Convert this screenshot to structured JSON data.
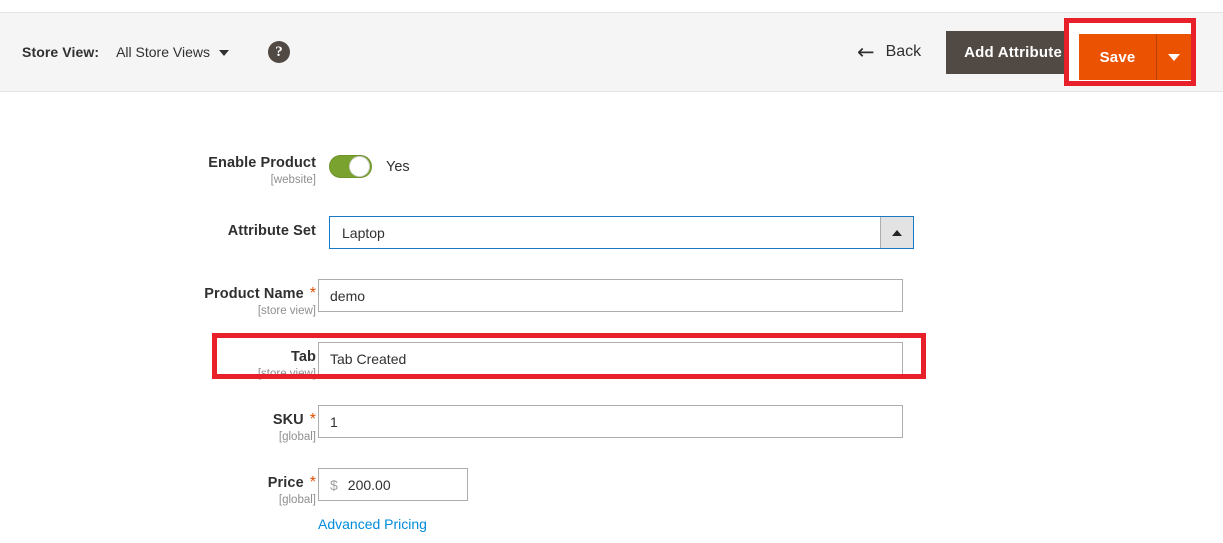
{
  "header": {
    "store_view_label": "Store View:",
    "store_view_value": "All Store Views",
    "store_view_caret_icon": "chevron-down-icon",
    "help_icon": "question-mark-icon",
    "help_glyph": "?",
    "back_arrow_icon": "arrow-left-icon",
    "back_arrow_glyph": "←",
    "back_label": "Back",
    "add_attribute_label": "Add Attribute",
    "save_label": "Save",
    "save_caret_icon": "chevron-down-icon"
  },
  "form": {
    "enable_product": {
      "label": "Enable Product",
      "scope": "[website]",
      "toggle_state": "Yes",
      "toggle_on": true
    },
    "attribute_set": {
      "label": "Attribute Set",
      "value": "Laptop",
      "arrow_icon": "chevron-up-icon"
    },
    "product_name": {
      "label": "Product Name",
      "scope": "[store view]",
      "required": "*",
      "value": "demo"
    },
    "tab": {
      "label": "Tab",
      "scope": "[store view]",
      "value": "Tab Created",
      "highlighted": true
    },
    "sku": {
      "label": "SKU",
      "scope": "[global]",
      "required": "*",
      "value": "1"
    },
    "price": {
      "label": "Price",
      "scope": "[global]",
      "required": "*",
      "currency": "$",
      "value": "200.00",
      "advanced_pricing_label": "Advanced Pricing"
    }
  },
  "colors": {
    "save_orange": "#eb5202",
    "add_attribute_dark": "#514943",
    "highlight_red": "#e8202a",
    "toggle_green": "#79a22e",
    "link_blue": "#008bdb",
    "focus_blue": "#1979c3",
    "required_orange": "#e04f00"
  }
}
